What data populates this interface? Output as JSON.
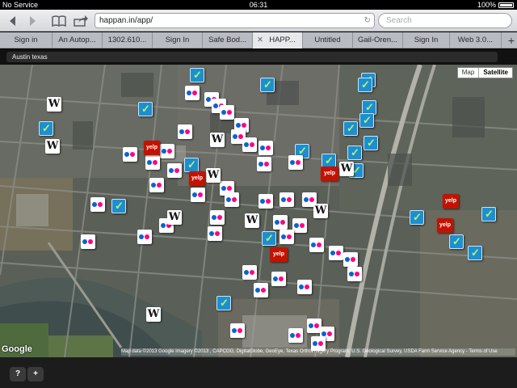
{
  "status": {
    "carrier": "No Service",
    "time": "06:31",
    "battery": "100%"
  },
  "toolbar": {
    "back_icon": "chevron-left-icon",
    "forward_icon": "chevron-right-icon",
    "bookmarks_icon": "book-icon",
    "share_icon": "share-icon",
    "url": "happan.in/app/",
    "reload_icon": "reload-icon",
    "search_placeholder": "Search"
  },
  "tabs": [
    {
      "label": "Sign in"
    },
    {
      "label": "An Autop..."
    },
    {
      "label": "1302.610..."
    },
    {
      "label": "Sign In"
    },
    {
      "label": "Safe Bod..."
    },
    {
      "label": "HAPP...",
      "active": true
    },
    {
      "label": "Untitled"
    },
    {
      "label": "Gail-Oren..."
    },
    {
      "label": "Sign In"
    },
    {
      "label": "Web 3.0..."
    }
  ],
  "mapbar": {
    "location": "Austin texas"
  },
  "map": {
    "type_map": "Map",
    "type_satellite": "Satellite",
    "logo": "Google",
    "credit": "Map data ©2013 Google Imagery ©2013 , CAPCOG, DigitalGlobe, GeoEye, Texas Orthoimagery Program, U.S. Geological Survey, USDA Farm Service Agency - Terms of Use",
    "yelp_label": "yelp",
    "wiki_label": "W"
  },
  "bottom": {
    "help_label": "?",
    "add_label": "+"
  }
}
